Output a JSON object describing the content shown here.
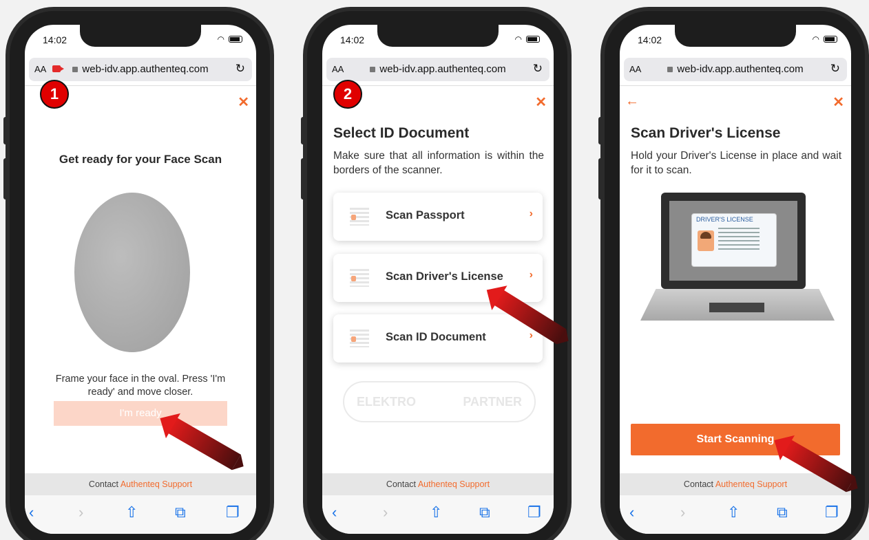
{
  "browser": {
    "time": "14:02",
    "text_size": "AA",
    "url": "web-idv.app.authenteq.com",
    "reload_glyph": "↻"
  },
  "footer": {
    "contact_prefix": "Contact",
    "support_link": "Authenteq Support"
  },
  "screen1": {
    "step_badge": "1",
    "title": "Get ready for your Face Scan",
    "instruction": "Frame your face in the oval. Press 'I'm ready' and move closer.",
    "ready_button": "I'm ready"
  },
  "screen2": {
    "step_badge": "2",
    "title": "Select ID Document",
    "instruction": "Make sure that all information is within the borders of the scanner.",
    "options": [
      {
        "label": "Scan Passport"
      },
      {
        "label": "Scan Driver's License"
      },
      {
        "label": "Scan ID Document"
      }
    ],
    "watermark_left": "ELEKTRO",
    "watermark_right": "PARTNER"
  },
  "screen3": {
    "title": "Scan Driver's License",
    "instruction": "Hold your Driver's License in place and wait for it to scan.",
    "card_heading": "DRIVER'S LICENSE",
    "start_button": "Start Scanning"
  },
  "colors": {
    "accent": "#f26b2d",
    "badge": "#e00000",
    "toolbar_icon": "#1a73e8"
  },
  "icons": [
    "close-icon",
    "back-arrow-icon",
    "lock-icon",
    "camera-icon",
    "reload-icon",
    "share-icon",
    "bookmarks-icon",
    "tabs-icon",
    "chevron-right-icon"
  ]
}
